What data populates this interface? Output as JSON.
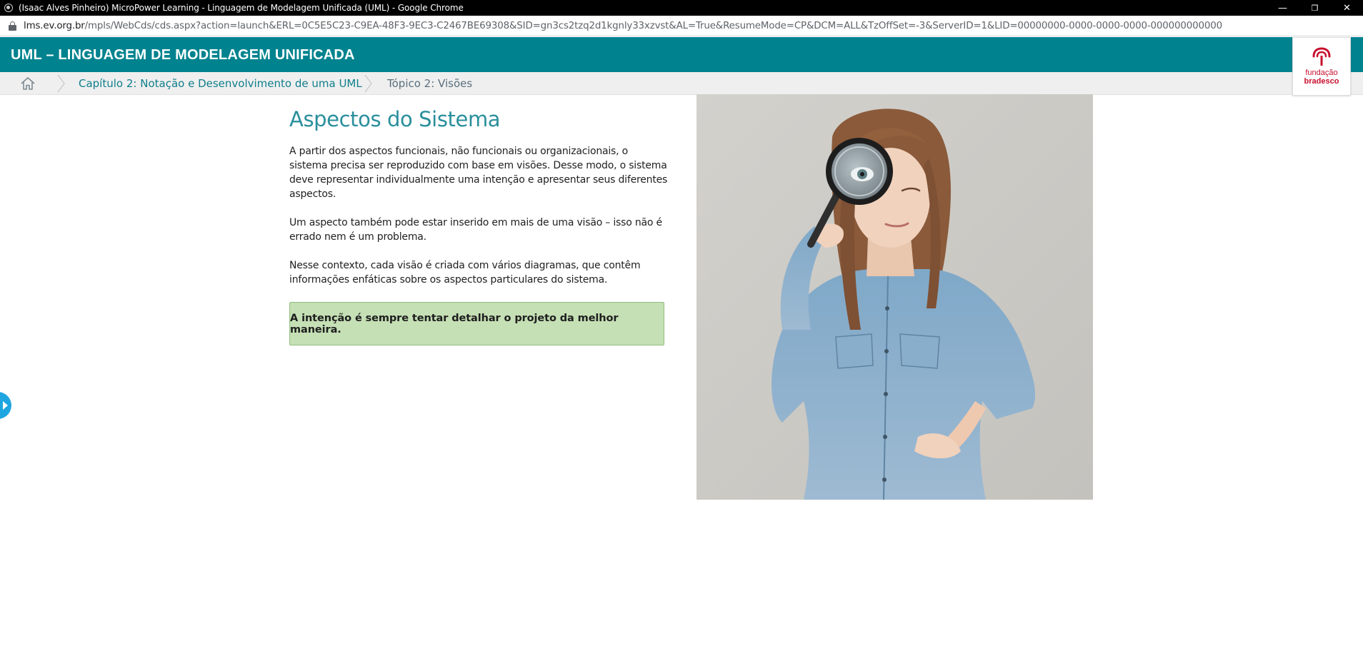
{
  "window": {
    "title": "(Isaac Alves Pinheiro) MicroPower Learning - Linguagem de Modelagem Unificada (UML) - Google Chrome",
    "minimize_glyph": "—",
    "restore_glyph": "❐",
    "close_glyph": "✕"
  },
  "address_bar": {
    "host": "lms.ev.org.br",
    "path": "/mpls/WebCds/cds.aspx?action=launch&ERL=0C5E5C23-C9EA-48F3-9EC3-C2467BE69308&SID=gn3cs2tzq2d1kgnly33xzvst&AL=True&ResumeMode=CP&DCM=ALL&TzOffSet=-3&ServerID=1&LID=00000000-0000-0000-0000-000000000000"
  },
  "header": {
    "course_title": "UML – LINGUAGEM DE MODELAGEM UNIFICADA",
    "logo_line1": "fundação",
    "logo_line2": "bradesco"
  },
  "breadcrumb": {
    "items": [
      {
        "label": "Capítulo 2: Notação e Desenvolvimento de uma UML"
      },
      {
        "label": "Tópico 2: Visões"
      }
    ]
  },
  "content": {
    "title": "Aspectos do Sistema",
    "paragraphs": [
      "A partir dos aspectos funcionais, não funcionais ou organizacionais, o sistema precisa ser reproduzido com base em visões. Desse modo, o sistema deve representar individualmente uma intenção e apresentar seus diferentes aspectos.",
      "Um aspecto também pode estar inserido em mais de uma visão – isso não é errado nem é um problema.",
      "Nesse contexto, cada visão é criada com vários diagramas, que contêm informações enfáticas sobre os aspectos particulares do sistema."
    ],
    "highlight": "A intenção é sempre tentar detalhar o projeto da melhor maneira."
  },
  "colors": {
    "header_teal": "#00838f",
    "title_teal": "#2a8f9c",
    "highlight_green": "#c5e0b5",
    "logo_red": "#c8102e",
    "side_toggle_blue": "#1fa6e0"
  },
  "icons": {
    "app": "chrome-icon",
    "lock": "lock-icon",
    "home": "home-icon",
    "logo": "fundacao-bradesco-tree-icon",
    "side": "chevron-right-icon"
  }
}
